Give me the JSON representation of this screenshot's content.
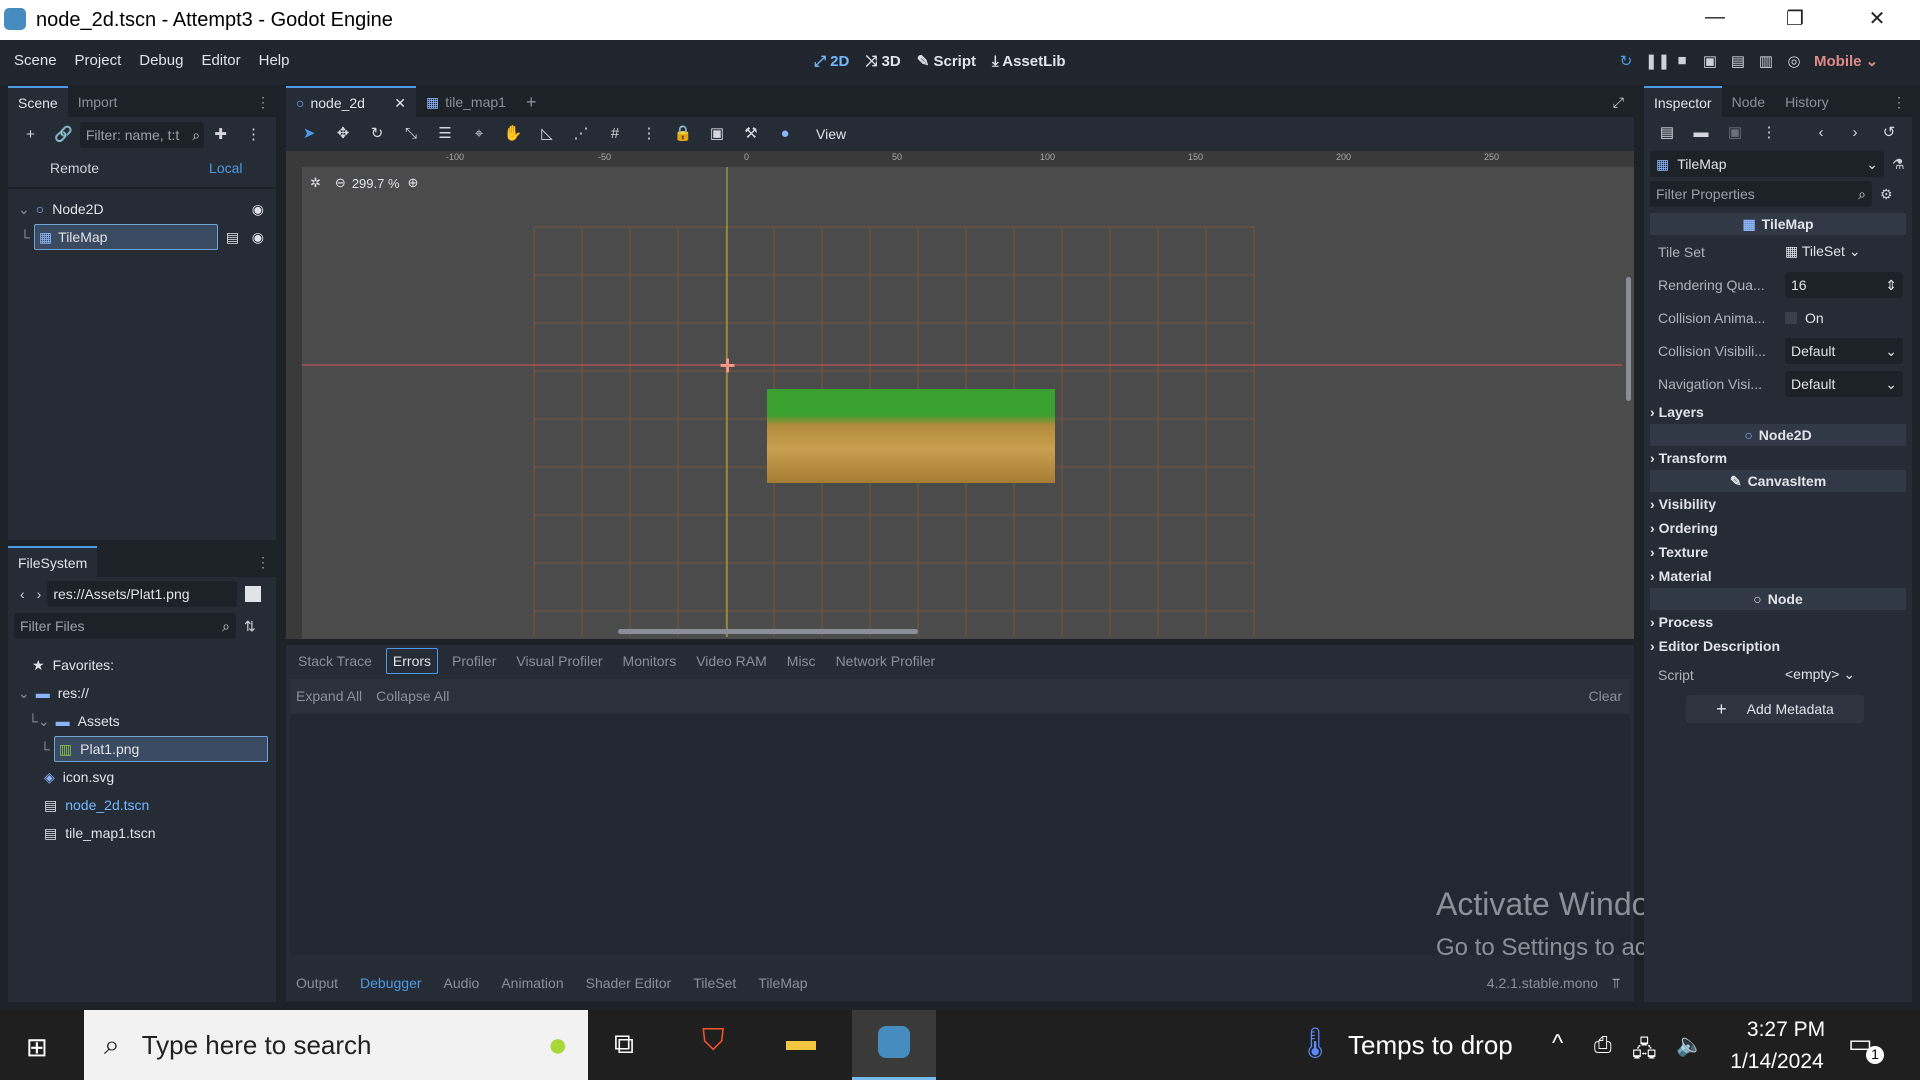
{
  "window": {
    "title": "node_2d.tscn - Attempt3 - Godot Engine",
    "min": "—",
    "restore": "❐",
    "close": "✕"
  },
  "menu": [
    "Scene",
    "Project",
    "Debug",
    "Editor",
    "Help"
  ],
  "modes": [
    "2D",
    "3D",
    "Script",
    "AssetLib"
  ],
  "renderer": "Mobile",
  "scene_dock": {
    "tabs": [
      "Scene",
      "Import"
    ],
    "filter_placeholder": "Filter: name, t:t",
    "remote": "Remote",
    "local": "Local",
    "tree": [
      "Node2D",
      "TileMap"
    ]
  },
  "filesystem": {
    "tab": "FileSystem",
    "path": "res://Assets/Plat1.png",
    "filter_placeholder": "Filter Files",
    "items": [
      "Favorites:",
      "res://",
      "Assets",
      "Plat1.png",
      "icon.svg",
      "node_2d.tscn",
      "tile_map1.tscn"
    ]
  },
  "editor_tabs": [
    "node_2d",
    "tile_map1"
  ],
  "toolbar": {
    "view": "View"
  },
  "ruler": [
    "-100",
    "-50",
    "0",
    "50",
    "100",
    "150",
    "200",
    "250"
  ],
  "zoom": "299.7 %",
  "debugger": {
    "tabs": [
      "Stack Trace",
      "Errors",
      "Profiler",
      "Visual Profiler",
      "Monitors",
      "Video RAM",
      "Misc",
      "Network Profiler"
    ],
    "expand_all": "Expand All",
    "collapse_all": "Collapse All",
    "clear": "Clear"
  },
  "bottom_tabs": [
    "Output",
    "Debugger",
    "Audio",
    "Animation",
    "Shader Editor",
    "TileSet",
    "TileMap"
  ],
  "version": "4.2.1.stable.mono",
  "watermark": {
    "line1": "Activate Windows",
    "line2": "Go to Settings to activate Windows."
  },
  "inspector": {
    "tabs": [
      "Inspector",
      "Node",
      "History"
    ],
    "object": "TileMap",
    "filter_placeholder": "Filter Properties",
    "header": "TileMap",
    "tile_set_label": "Tile Set",
    "tile_set_value": "TileSet",
    "rendering_label": "Rendering Qua...",
    "rendering_value": "16",
    "collision_anim_label": "Collision Anima...",
    "collision_anim_value": "On",
    "collision_vis_label": "Collision Visibili...",
    "collision_vis_value": "Default",
    "nav_vis_label": "Navigation Visi...",
    "nav_vis_value": "Default",
    "layers": "Layers",
    "node2d": "Node2D",
    "transform": "Transform",
    "canvasitem": "CanvasItem",
    "visibility": "Visibility",
    "ordering": "Ordering",
    "texture": "Texture",
    "material": "Material",
    "node": "Node",
    "process": "Process",
    "editor_desc": "Editor Description",
    "script_label": "Script",
    "script_value": "<empty>",
    "add_metadata": "Add Metadata"
  },
  "taskbar": {
    "search": "Type here to search",
    "weather": "Temps to drop",
    "time": "3:27 PM",
    "date": "1/14/2024",
    "notif": "1"
  }
}
